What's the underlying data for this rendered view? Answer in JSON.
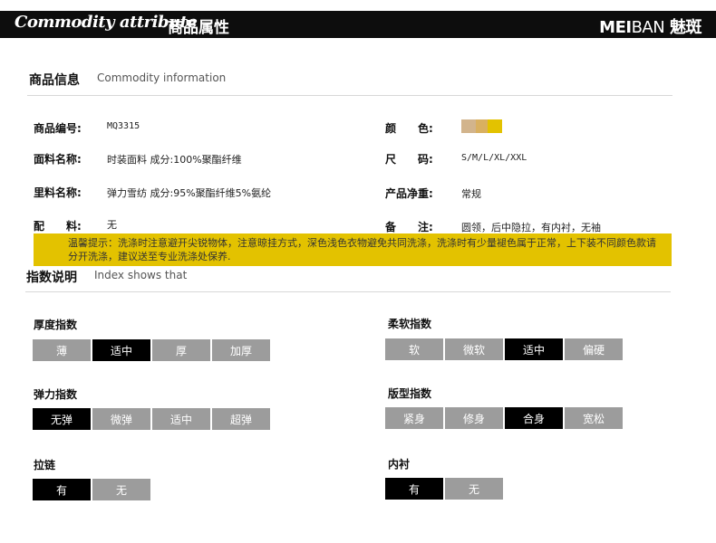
{
  "header": {
    "title_en": "Commodity attribute",
    "title_cn": "商品属性",
    "brand_bold": "MEI",
    "brand_light": "BAN",
    "brand_cn": "魅斑"
  },
  "info": {
    "title": "商品信息",
    "subtitle": "Commodity information",
    "rows": {
      "code_label": "商品编号:",
      "code_value": "MQ3315",
      "color_label": "颜　　色:",
      "fabric_label": "面料名称:",
      "fabric_value": "时装面料 成分:100%聚酯纤维",
      "size_label": "尺　　码:",
      "size_value": "S/M/L/XL/XXL",
      "lining_label": "里料名称:",
      "lining_value": "弹力雪纺 成分:95%聚酯纤维5%氨纶",
      "weight_label": "产品净重:",
      "weight_value": "常规",
      "accessory_label": "配　　料:",
      "accessory_value": "无",
      "remark_label": "备　　注:",
      "remark_value": "圆领，后中隐拉，有内衬，无袖"
    },
    "colors": [
      "#d2b48c",
      "#e3c200"
    ],
    "notice": "温馨提示：洗涤时注意避开尖锐物体，注意晾挂方式，深色浅色衣物避免共同洗涤，洗涤时有少量褪色属于正常，上下装不同颜色款请分开洗涤，建议送至专业洗涤处保养."
  },
  "index": {
    "title": "指数说明",
    "subtitle": "Index shows that",
    "thickness": {
      "title": "厚度指数",
      "options": [
        "薄",
        "适中",
        "厚",
        "加厚"
      ],
      "selected": 1
    },
    "softness": {
      "title": "柔软指数",
      "options": [
        "软",
        "微软",
        "适中",
        "偏硬"
      ],
      "selected": 2
    },
    "elasticity": {
      "title": "弹力指数",
      "options": [
        "无弹",
        "微弹",
        "适中",
        "超弹"
      ],
      "selected": 0
    },
    "fit": {
      "title": "版型指数",
      "options": [
        "紧身",
        "修身",
        "合身",
        "宽松"
      ],
      "selected": 2
    },
    "zipper": {
      "title": "拉链",
      "options": [
        "有",
        "无"
      ],
      "selected": 0
    },
    "inner": {
      "title": "内衬",
      "options": [
        "有",
        "无"
      ],
      "selected": 0
    }
  }
}
